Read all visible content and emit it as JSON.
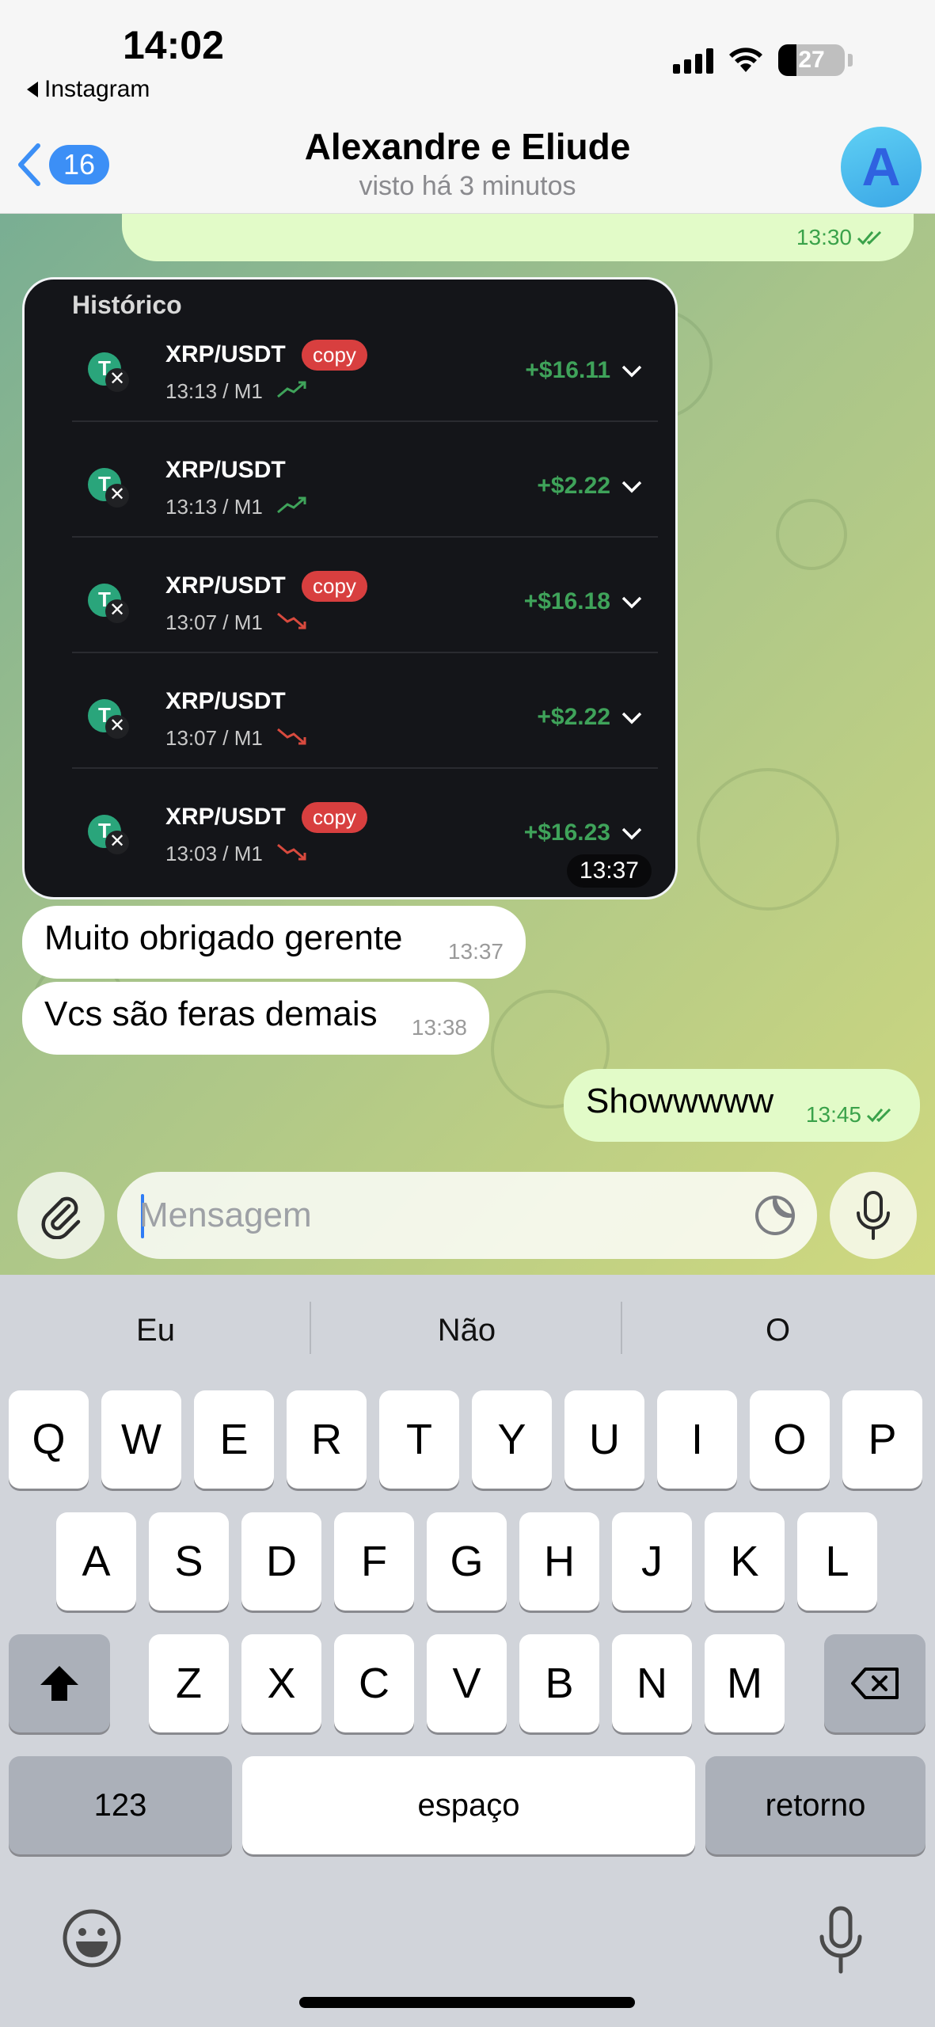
{
  "status_bar": {
    "time": "14:02",
    "back_app": "Instagram",
    "battery": "27",
    "battery_level": 0.27
  },
  "header": {
    "unread_count": "16",
    "title": "Alexandre e Eliude",
    "subtitle": "visto há 3 minutos",
    "avatar_letter": "A"
  },
  "messages": {
    "prev_out_time": "13:30",
    "card": {
      "title": "Histórico",
      "time": "13:37",
      "trades": [
        {
          "pair": "XRP/USDT",
          "tag": "copy",
          "meta": "13:13 / M1",
          "trend": "up",
          "amount": "+$16.11"
        },
        {
          "pair": "XRP/USDT",
          "tag": "",
          "meta": "13:13 / M1",
          "trend": "up",
          "amount": "+$2.22"
        },
        {
          "pair": "XRP/USDT",
          "tag": "copy",
          "meta": "13:07 / M1",
          "trend": "down",
          "amount": "+$16.18"
        },
        {
          "pair": "XRP/USDT",
          "tag": "",
          "meta": "13:07 / M1",
          "trend": "down",
          "amount": "+$2.22"
        },
        {
          "pair": "XRP/USDT",
          "tag": "copy",
          "meta": "13:03 / M1",
          "trend": "down",
          "amount": "+$16.23"
        }
      ]
    },
    "in1": {
      "text": "Muito obrigado gerente",
      "time": "13:37"
    },
    "in2": {
      "text": "Vcs são feras demais",
      "time": "13:38"
    },
    "out1": {
      "text": "Showwwww",
      "time": "13:45"
    }
  },
  "composer": {
    "placeholder": "Mensagem"
  },
  "keyboard": {
    "suggestions": [
      "Eu",
      "Não",
      "O"
    ],
    "row1": [
      "Q",
      "W",
      "E",
      "R",
      "T",
      "Y",
      "U",
      "I",
      "O",
      "P"
    ],
    "row2": [
      "A",
      "S",
      "D",
      "F",
      "G",
      "H",
      "J",
      "K",
      "L"
    ],
    "row3": [
      "Z",
      "X",
      "C",
      "V",
      "B",
      "N",
      "M"
    ],
    "numbers_key": "123",
    "space_key": "espaço",
    "return_key": "retorno"
  },
  "colors": {
    "accent": "#3c8ff6",
    "outgoing": "#e2fbc8",
    "profit": "#3fa35a",
    "copy_tag": "#d83f3f"
  }
}
